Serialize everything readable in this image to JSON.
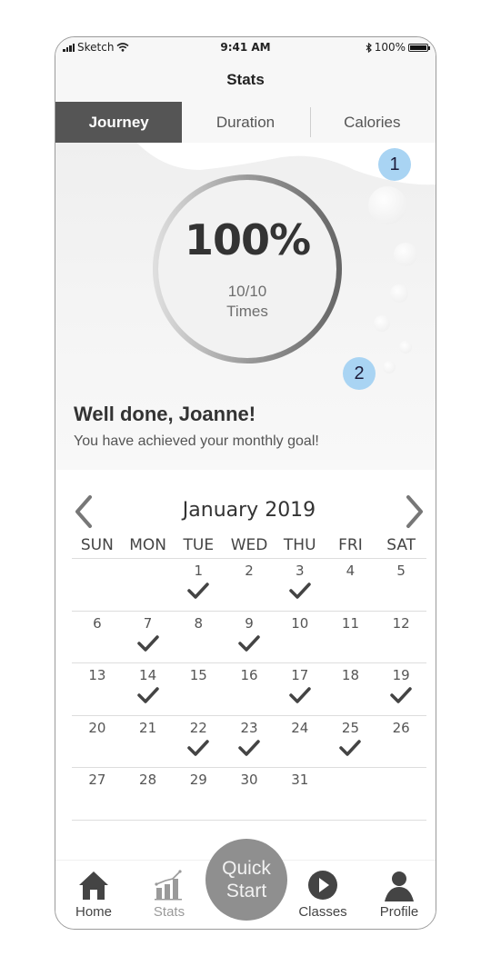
{
  "status_bar": {
    "carrier": "Sketch",
    "time": "9:41 AM",
    "battery": "100%",
    "battery_level_percent": 100
  },
  "header": {
    "title": "Stats"
  },
  "tabs": [
    {
      "label": "Journey",
      "active": true
    },
    {
      "label": "Duration",
      "active": false
    },
    {
      "label": "Calories",
      "active": false
    }
  ],
  "progress": {
    "percent_label": "100%",
    "percent_value": 100,
    "count": "10/10",
    "unit": "Times"
  },
  "annotations": [
    "1",
    "2"
  ],
  "congrats": {
    "title": "Well done, Joanne!",
    "subtitle": "You have achieved your monthly goal!"
  },
  "calendar": {
    "title": "January 2019",
    "weekdays": [
      "SUN",
      "MON",
      "TUE",
      "WED",
      "THU",
      "FRI",
      "SAT"
    ],
    "weeks": [
      [
        {
          "d": ""
        },
        {
          "d": ""
        },
        {
          "d": "1",
          "done": true
        },
        {
          "d": "2"
        },
        {
          "d": "3",
          "done": true
        },
        {
          "d": "4"
        },
        {
          "d": "5"
        }
      ],
      [
        {
          "d": "6"
        },
        {
          "d": "7",
          "done": true
        },
        {
          "d": "8"
        },
        {
          "d": "9",
          "done": true
        },
        {
          "d": "10"
        },
        {
          "d": "11"
        },
        {
          "d": "12"
        }
      ],
      [
        {
          "d": "13"
        },
        {
          "d": "14",
          "done": true
        },
        {
          "d": "15"
        },
        {
          "d": "16"
        },
        {
          "d": "17",
          "done": true
        },
        {
          "d": "18"
        },
        {
          "d": "19",
          "done": true
        }
      ],
      [
        {
          "d": "20"
        },
        {
          "d": "21"
        },
        {
          "d": "22",
          "done": true
        },
        {
          "d": "23",
          "done": true
        },
        {
          "d": "24"
        },
        {
          "d": "25",
          "done": true
        },
        {
          "d": "26"
        }
      ],
      [
        {
          "d": "27"
        },
        {
          "d": "28"
        },
        {
          "d": "29"
        },
        {
          "d": "30"
        },
        {
          "d": "31"
        },
        {
          "d": ""
        },
        {
          "d": ""
        }
      ]
    ]
  },
  "bottom_nav": {
    "items": [
      {
        "label": "Home",
        "icon": "home-icon"
      },
      {
        "label": "Stats",
        "icon": "stats-icon"
      },
      {
        "label": "Classes",
        "icon": "play-circle-icon"
      },
      {
        "label": "Profile",
        "icon": "person-icon"
      }
    ],
    "quick_start": {
      "line1": "Quick",
      "line2": "Start"
    }
  },
  "colors": {
    "active_tab": "#555555",
    "badge": "#a9d4f3",
    "quick_start": "#8f8f8f"
  }
}
